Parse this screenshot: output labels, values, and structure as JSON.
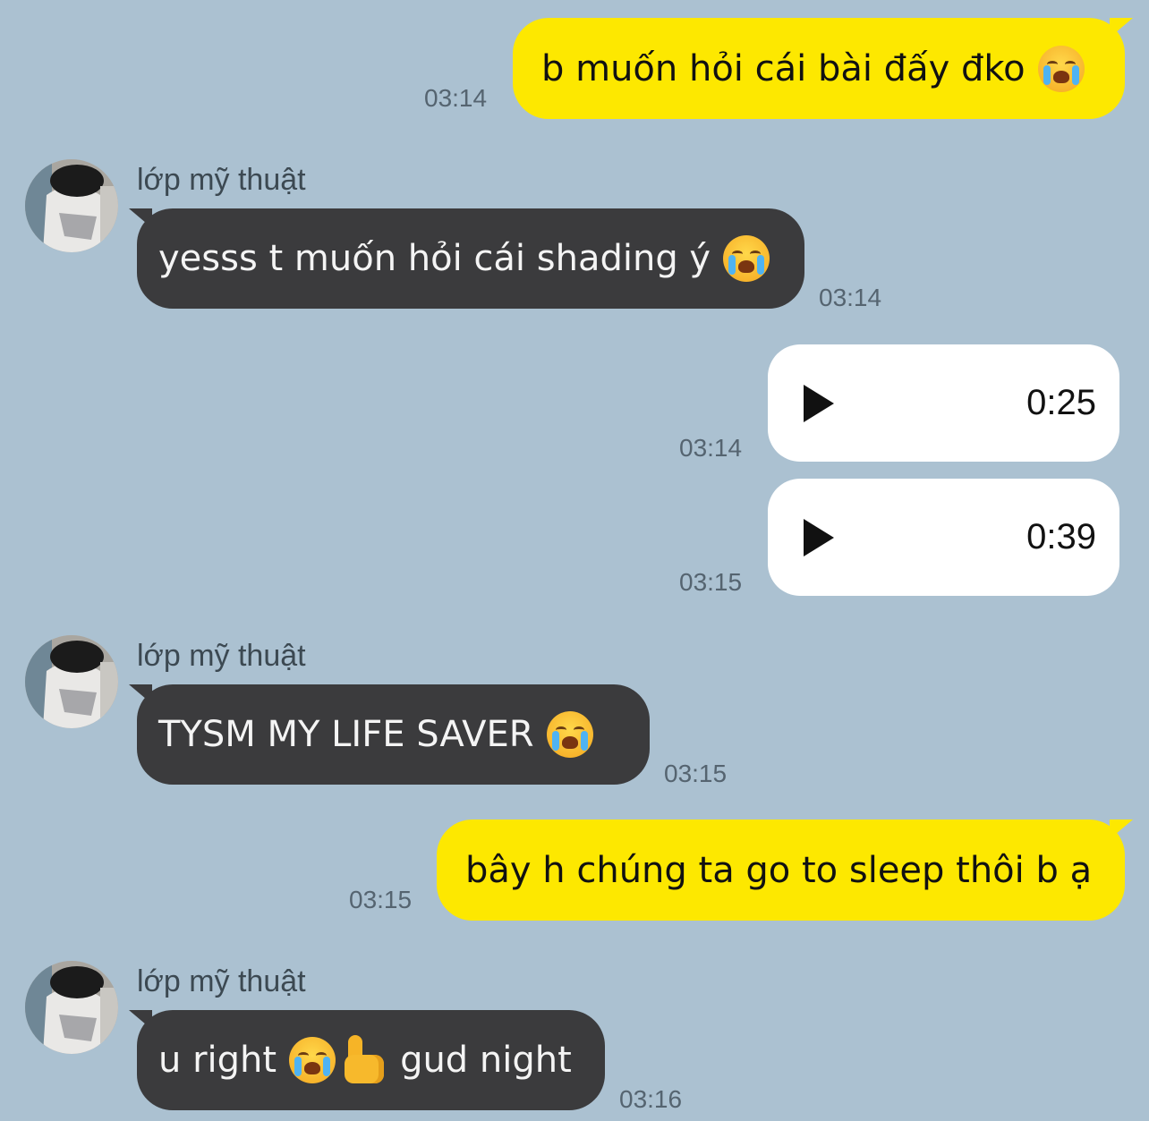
{
  "messages": [
    {
      "direction": "out",
      "text": "b muốn hỏi cái bài đấy đko",
      "emoji": "loudly-crying-face",
      "time": "03:14"
    },
    {
      "direction": "in",
      "sender": "lớp mỹ thuật",
      "text": "yesss t muốn hỏi cái shading ý",
      "emoji": "loudly-crying-face",
      "time": "03:14"
    },
    {
      "direction": "out",
      "type": "voice",
      "duration": "0:25",
      "time": "03:14"
    },
    {
      "direction": "out",
      "type": "voice",
      "duration": "0:39",
      "time": "03:15"
    },
    {
      "direction": "in",
      "sender": "lớp mỹ thuật",
      "text": "TYSM MY LIFE SAVER",
      "emoji": "loudly-crying-face",
      "time": "03:15"
    },
    {
      "direction": "out",
      "text": "bây h chúng ta go to sleep thôi b ạ",
      "time": "03:15"
    },
    {
      "direction": "in",
      "sender": "lớp mỹ thuật",
      "text_before": "u right",
      "emojis": [
        "loudly-crying-face",
        "thumbs-up"
      ],
      "text_after": "gud night",
      "time": "03:16"
    }
  ],
  "colors": {
    "background": "#abc1d1",
    "outgoing_bubble": "#fde800",
    "incoming_bubble": "#3b3b3d",
    "voice_bubble": "#ffffff"
  }
}
